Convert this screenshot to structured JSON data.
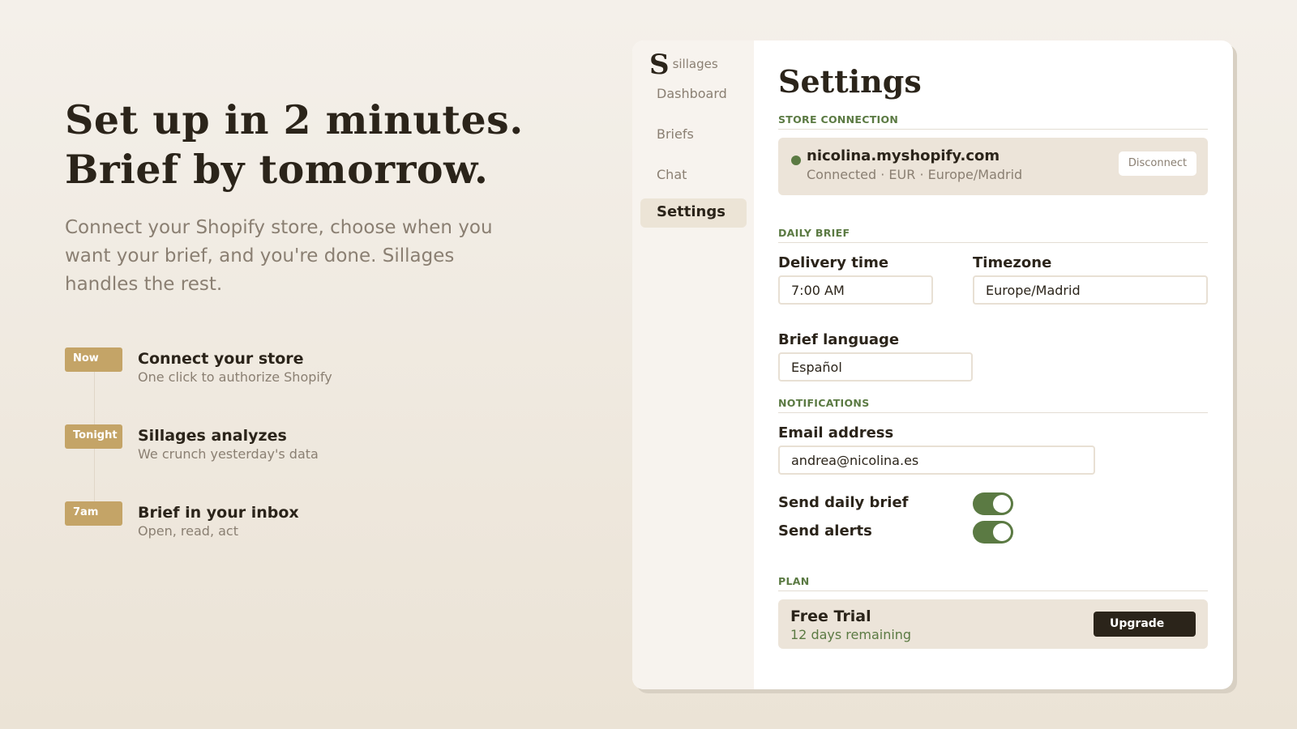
{
  "hero": {
    "title_line1": "Set up in 2 minutes.",
    "title_line2": "Brief by tomorrow.",
    "subtitle": "Connect your Shopify store, choose when you want your brief, and you're done. Sillages handles the rest."
  },
  "steps": [
    {
      "badge": "Now",
      "title": "Connect your store",
      "desc": "One click to authorize Shopify"
    },
    {
      "badge": "Tonight",
      "title": "Sillages analyzes",
      "desc": "We crunch yesterday's data"
    },
    {
      "badge": "7am",
      "title": "Brief in your inbox",
      "desc": "Open, read, act"
    }
  ],
  "app": {
    "logo_mark": "S",
    "logo_name": "sillages",
    "nav": [
      {
        "label": "Dashboard",
        "active": false
      },
      {
        "label": "Briefs",
        "active": false
      },
      {
        "label": "Chat",
        "active": false
      },
      {
        "label": "Settings",
        "active": true
      }
    ],
    "page_title": "Settings",
    "store_connection": {
      "label": "STORE CONNECTION",
      "store": "nicolina.myshopify.com",
      "meta": "Connected · EUR · Europe/Madrid",
      "disconnect": "Disconnect"
    },
    "daily_brief": {
      "label": "DAILY BRIEF",
      "delivery_label": "Delivery time",
      "delivery_value": "7:00 AM",
      "timezone_label": "Timezone",
      "timezone_value": "Europe/Madrid",
      "language_label": "Brief language",
      "language_value": "Español"
    },
    "notifications": {
      "label": "NOTIFICATIONS",
      "email_label": "Email address",
      "email_value": "andrea@nicolina.es",
      "daily_label": "Send daily brief",
      "daily_on": true,
      "alerts_label": "Send alerts",
      "alerts_on": true
    },
    "plan": {
      "label": "PLAN",
      "name": "Free Trial",
      "remaining": "12 days remaining",
      "upgrade": "Upgrade"
    }
  },
  "colors": {
    "accent_green": "#5b7a43",
    "badge_gold": "#c4a467",
    "ink": "#2b241a"
  }
}
